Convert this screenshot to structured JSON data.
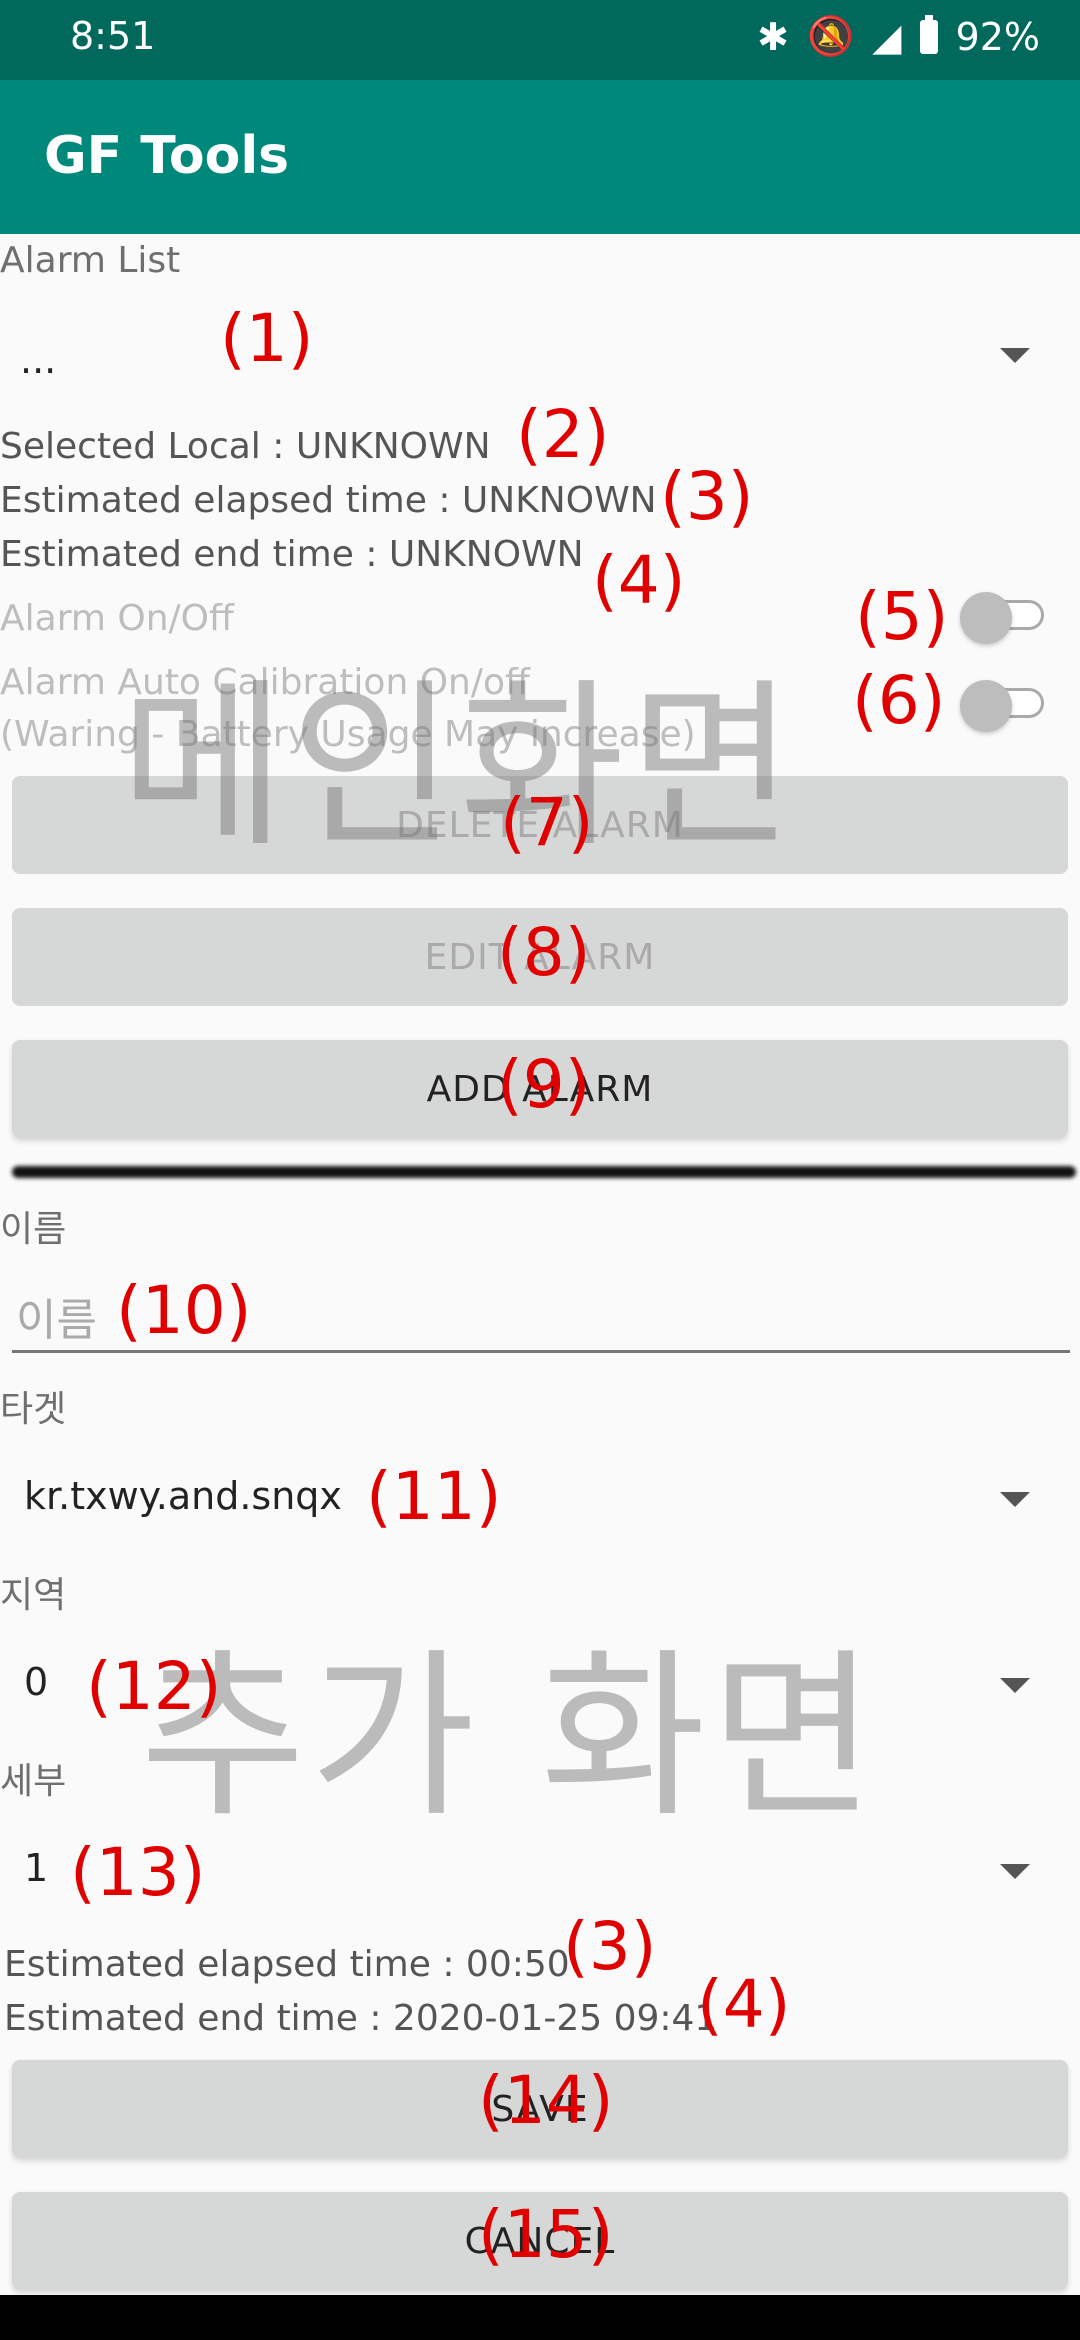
{
  "status_bar": {
    "time": "8:51",
    "battery": "92%",
    "icons": [
      "bluetooth-icon",
      "bell-off-icon",
      "signal-icon",
      "battery-icon"
    ]
  },
  "app_bar": {
    "title": "GF Tools"
  },
  "main_screen": {
    "alarm_list_label": "Alarm List",
    "alarm_list_value": "...",
    "selected_local": "Selected Local : UNKNOWN",
    "estimated_elapsed": "Estimated elapsed time : UNKNOWN",
    "estimated_end": "Estimated end time : UNKNOWN",
    "alarm_onoff_label": "Alarm On/Off",
    "auto_calibration_label_line1": "Alarm Auto Calibration On/off",
    "auto_calibration_label_line2": "(Waring - Battery Usage May increase)",
    "alarm_onoff_state": false,
    "auto_calibration_state": false,
    "delete_button": "DELETE ALARM",
    "edit_button": "EDIT ALARM",
    "add_button": "ADD ALARM"
  },
  "add_screen": {
    "name_label": "이름",
    "name_placeholder": "이름",
    "target_label": "타겟",
    "target_value": "kr.txwy.and.snqx",
    "region_label": "지역",
    "region_value": "0",
    "detail_label": "세부",
    "detail_value": "1",
    "estimated_elapsed": "Estimated elapsed time : 00:50",
    "estimated_end": "Estimated end time : 2020-01-25 09:41",
    "save_button": "SAVE",
    "cancel_button": "CANCEL"
  },
  "annotations": {
    "a1": "(1)",
    "a2": "(2)",
    "a3": "(3)",
    "a4": "(4)",
    "a5": "(5)",
    "a6": "(6)",
    "a7": "(7)",
    "a8": "(8)",
    "a9": "(9)",
    "a10": "(10)",
    "a11": "(11)",
    "a12": "(12)",
    "a13": "(13)",
    "a3b": "(3)",
    "a4b": "(4)",
    "a14": "(14)",
    "a15": "(15)"
  },
  "watermarks": {
    "main": "메인화면",
    "add": "추가 화면"
  },
  "colors": {
    "statusbar": "#00695c",
    "appbar": "#00897b",
    "annotation": "#e00000"
  }
}
